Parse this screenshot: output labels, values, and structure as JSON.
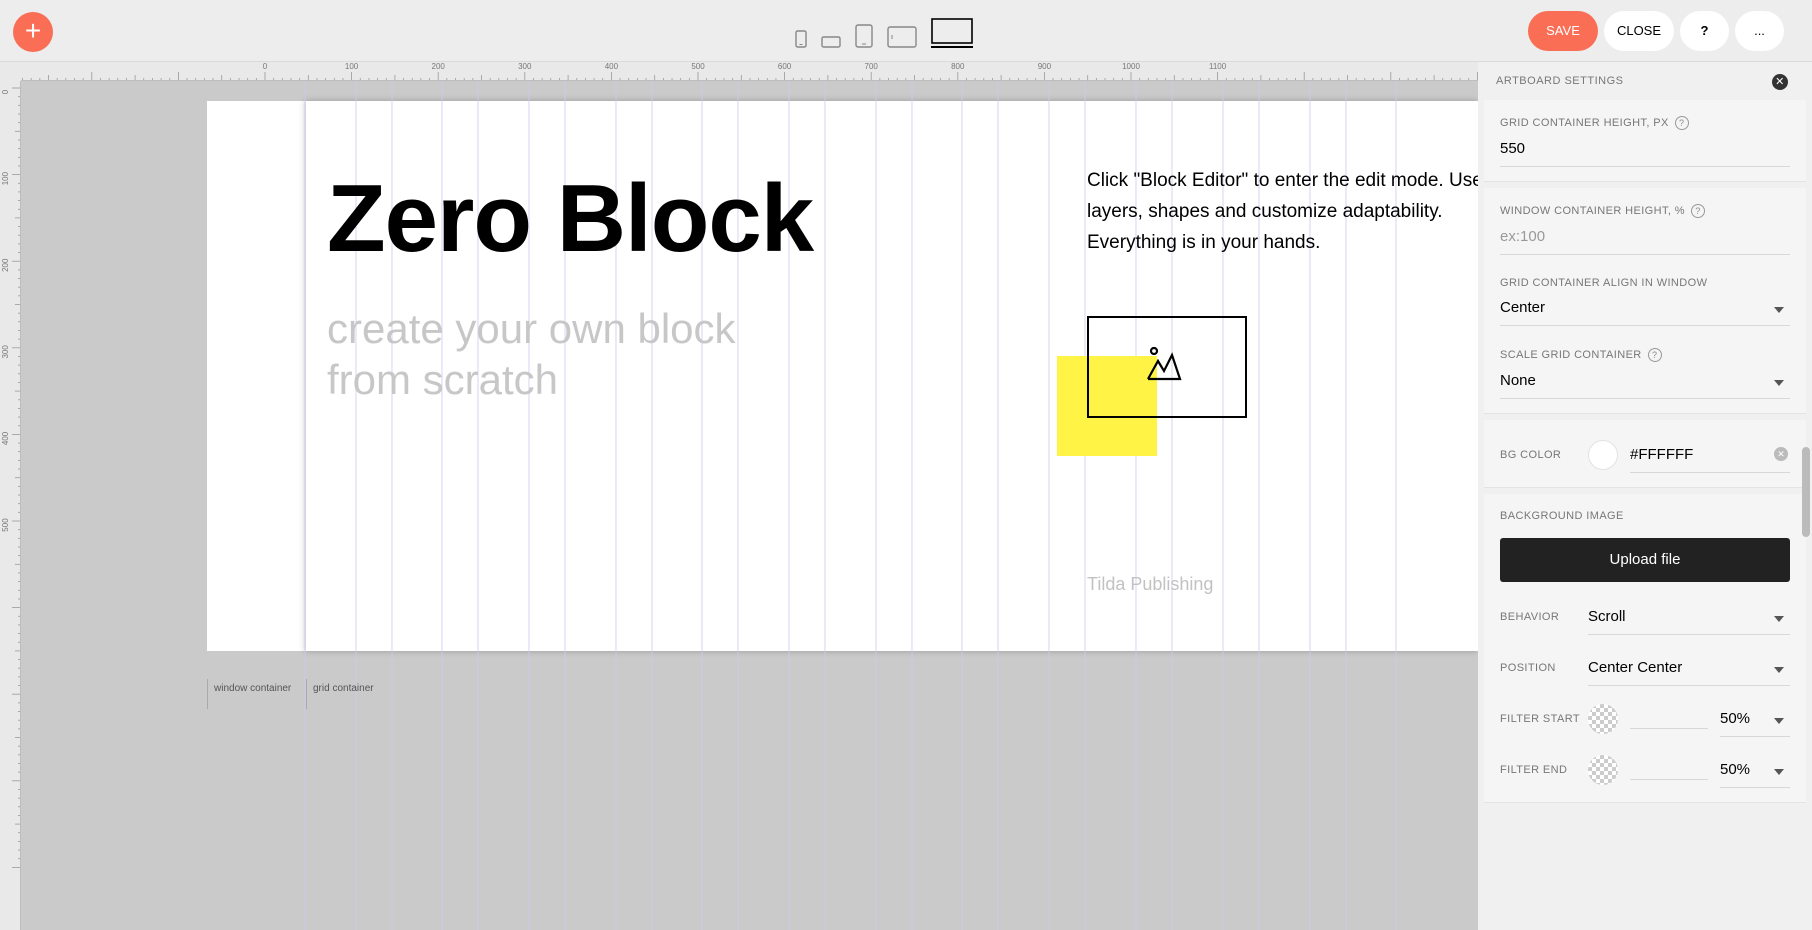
{
  "toolbar": {
    "add_label": "+",
    "save_label": "SAVE",
    "close_label": "CLOSE",
    "help_label": "?",
    "more_label": "..."
  },
  "devices": [
    "mobile-portrait",
    "mobile-landscape",
    "tablet-portrait",
    "tablet-landscape",
    "desktop"
  ],
  "active_device": "desktop",
  "ruler": {
    "top_ticks": [
      "0",
      "100",
      "200",
      "300",
      "400",
      "500",
      "600",
      "700",
      "800",
      "900",
      "1000",
      "1100"
    ],
    "left_ticks": [
      "0",
      "100",
      "200",
      "300",
      "400",
      "500"
    ]
  },
  "artboard": {
    "title": "Zero Block",
    "subtitle": "create your own block from scratch",
    "description": "Click \"Block Editor\" to enter the edit mode. Use layers, shapes and customize adaptability. Everything is in your hands.",
    "footer": "Tilda Publishing",
    "window_container_label": "window container",
    "grid_container_label": "grid container",
    "accent": "#fff445"
  },
  "panel": {
    "title": "ARTBOARD SETTINGS",
    "grid_height_label": "GRID CONTAINER HEIGHT, PX",
    "grid_height_value": "550",
    "window_height_label": "WINDOW CONTAINER HEIGHT, %",
    "window_height_placeholder": "ex:100",
    "align_label": "GRID CONTAINER ALIGN IN WINDOW",
    "align_value": "Center",
    "scale_label": "SCALE GRID CONTAINER",
    "scale_value": "None",
    "bg_color_label": "BG COLOR",
    "bg_color_value": "#FFFFFF",
    "bg_image_label": "BACKGROUND IMAGE",
    "upload_label": "Upload file",
    "behavior_label": "BEHAVIOR",
    "behavior_value": "Scroll",
    "position_label": "POSITION",
    "position_value": "Center Center",
    "filter_start_label": "FILTER START",
    "filter_start_value": "50%",
    "filter_end_label": "FILTER END",
    "filter_end_value": "50%"
  },
  "colors": {
    "brand": "#fa6e56",
    "toolbar_bg": "#ededed",
    "canvas_bg": "#cacaca"
  }
}
